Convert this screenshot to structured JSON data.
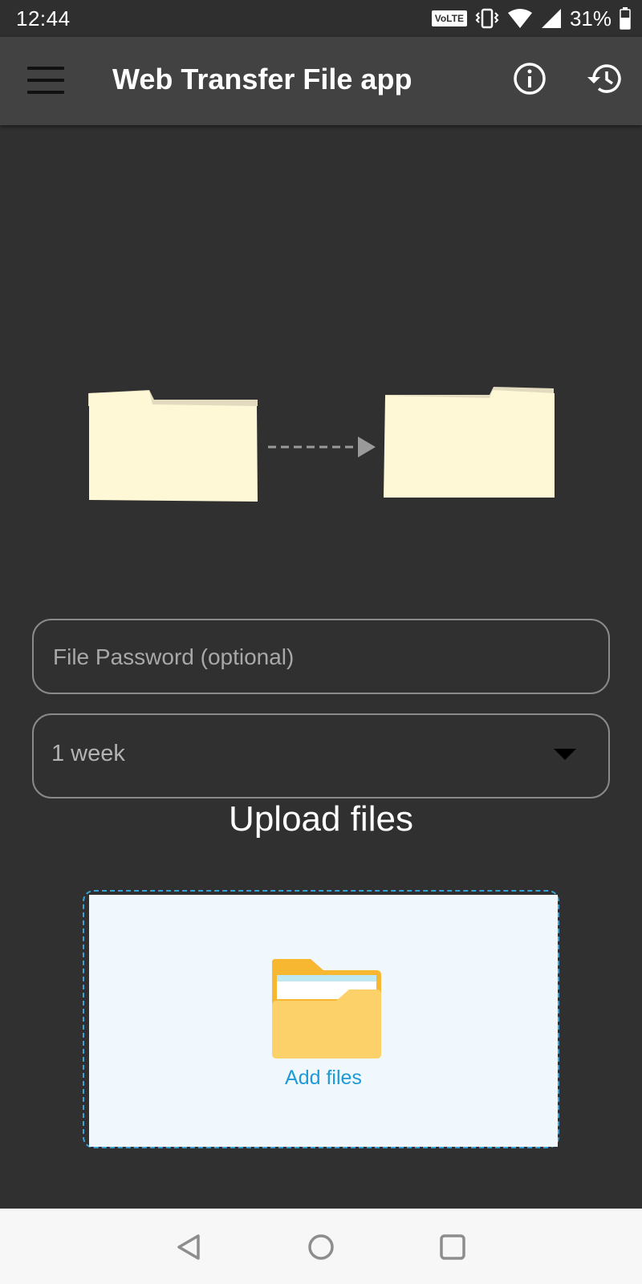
{
  "status_bar": {
    "time": "12:44",
    "network_badge": "VoLTE",
    "battery": "31%",
    "icons": [
      "vibrate-icon",
      "wifi-icon",
      "signal-icon",
      "battery-icon"
    ]
  },
  "app_bar": {
    "title": "Web Transfer File app",
    "icons": [
      "menu-icon",
      "info-icon",
      "history-icon"
    ]
  },
  "illustration": {
    "icons": [
      "source-folder-icon",
      "transfer-arrow-icon",
      "destination-folder-icon"
    ]
  },
  "form": {
    "password_placeholder": "File Password (optional)",
    "password_value": "",
    "duration_selected": "1 week"
  },
  "upload": {
    "heading": "Upload files",
    "add_files_label": "Add files",
    "icon": "folder-icon"
  },
  "nav_bar": {
    "icons": [
      "back-icon",
      "home-icon",
      "recents-icon"
    ]
  },
  "colors": {
    "background": "#303030",
    "app_bar": "#424242",
    "accent": "#1e9ad6",
    "dropzone_bg": "#f0f8fd",
    "folder_illustration": "#fff8d6"
  }
}
